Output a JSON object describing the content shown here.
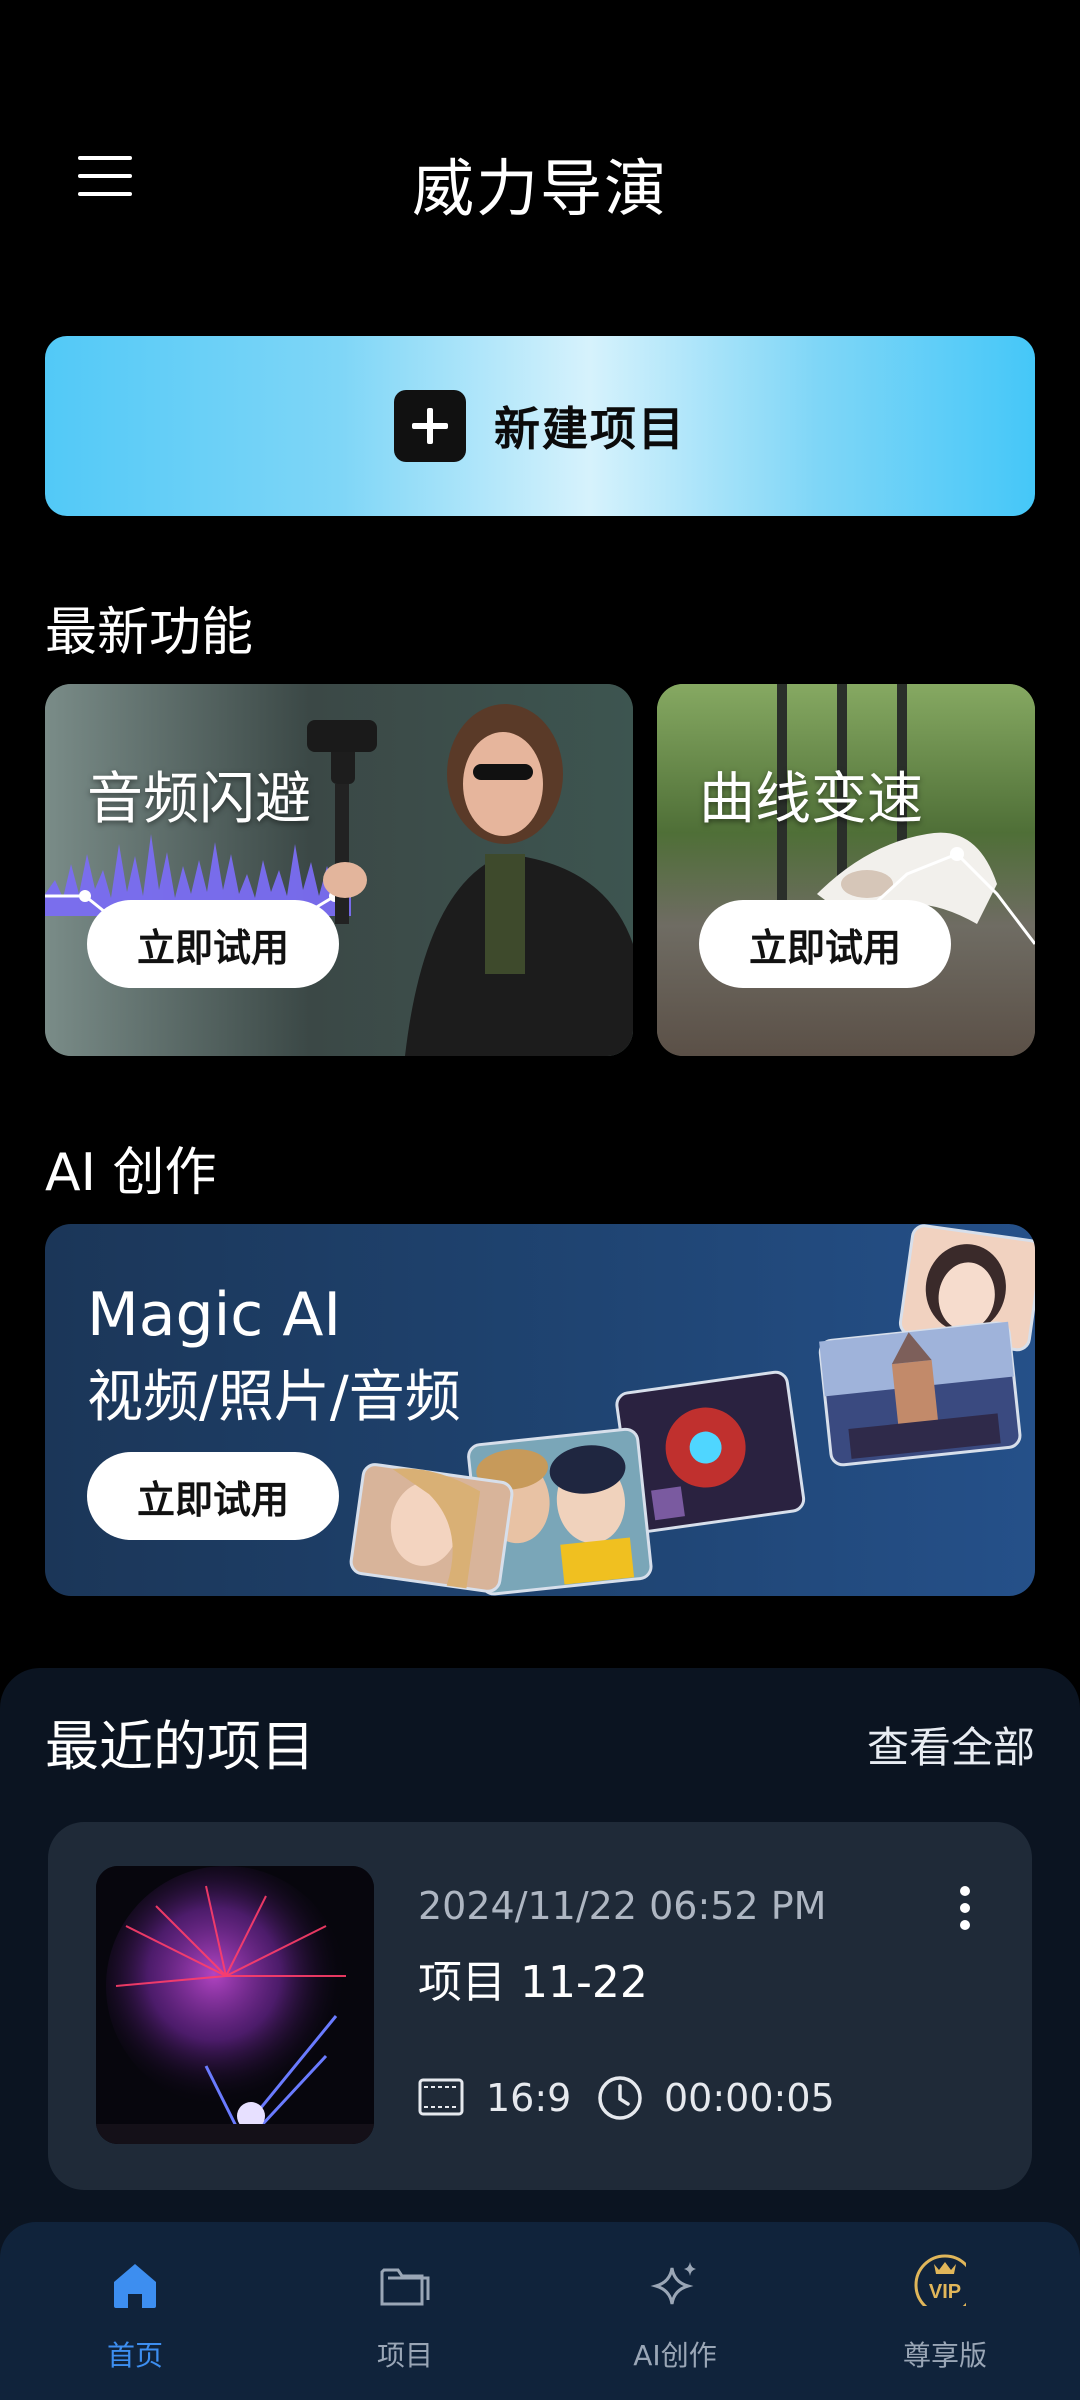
{
  "header": {
    "title": "威力导演"
  },
  "new_project": {
    "label": "新建项目"
  },
  "sections": {
    "new_features": "最新功能",
    "ai_create": "AI 创作"
  },
  "feature_cards": [
    {
      "title": "音频闪避",
      "button": "立即试用"
    },
    {
      "title": "曲线变速",
      "button": "立即试用"
    }
  ],
  "ai_banner": {
    "line1": "Magic AI",
    "line2": "视频/照片/音频",
    "button": "立即试用"
  },
  "recent": {
    "title": "最近的项目",
    "view_all": "查看全部",
    "project": {
      "date": "2024/11/22   06:52 PM",
      "name": "项目 11-22",
      "ratio": "16:9",
      "duration": "00:00:05"
    }
  },
  "tabbar": [
    {
      "label": "首页",
      "icon": "home-icon",
      "active": true
    },
    {
      "label": "项目",
      "icon": "folder-icon",
      "active": false
    },
    {
      "label": "AI创作",
      "icon": "sparkle-icon",
      "active": false
    },
    {
      "label": "尊享版",
      "icon": "vip-crown-icon",
      "active": false
    }
  ],
  "colors": {
    "accent": "#3d8ef0",
    "new_project_gradient": "#52c9f7",
    "card_bg": "#1f2a38",
    "tabbar_bg": "#10233b"
  }
}
